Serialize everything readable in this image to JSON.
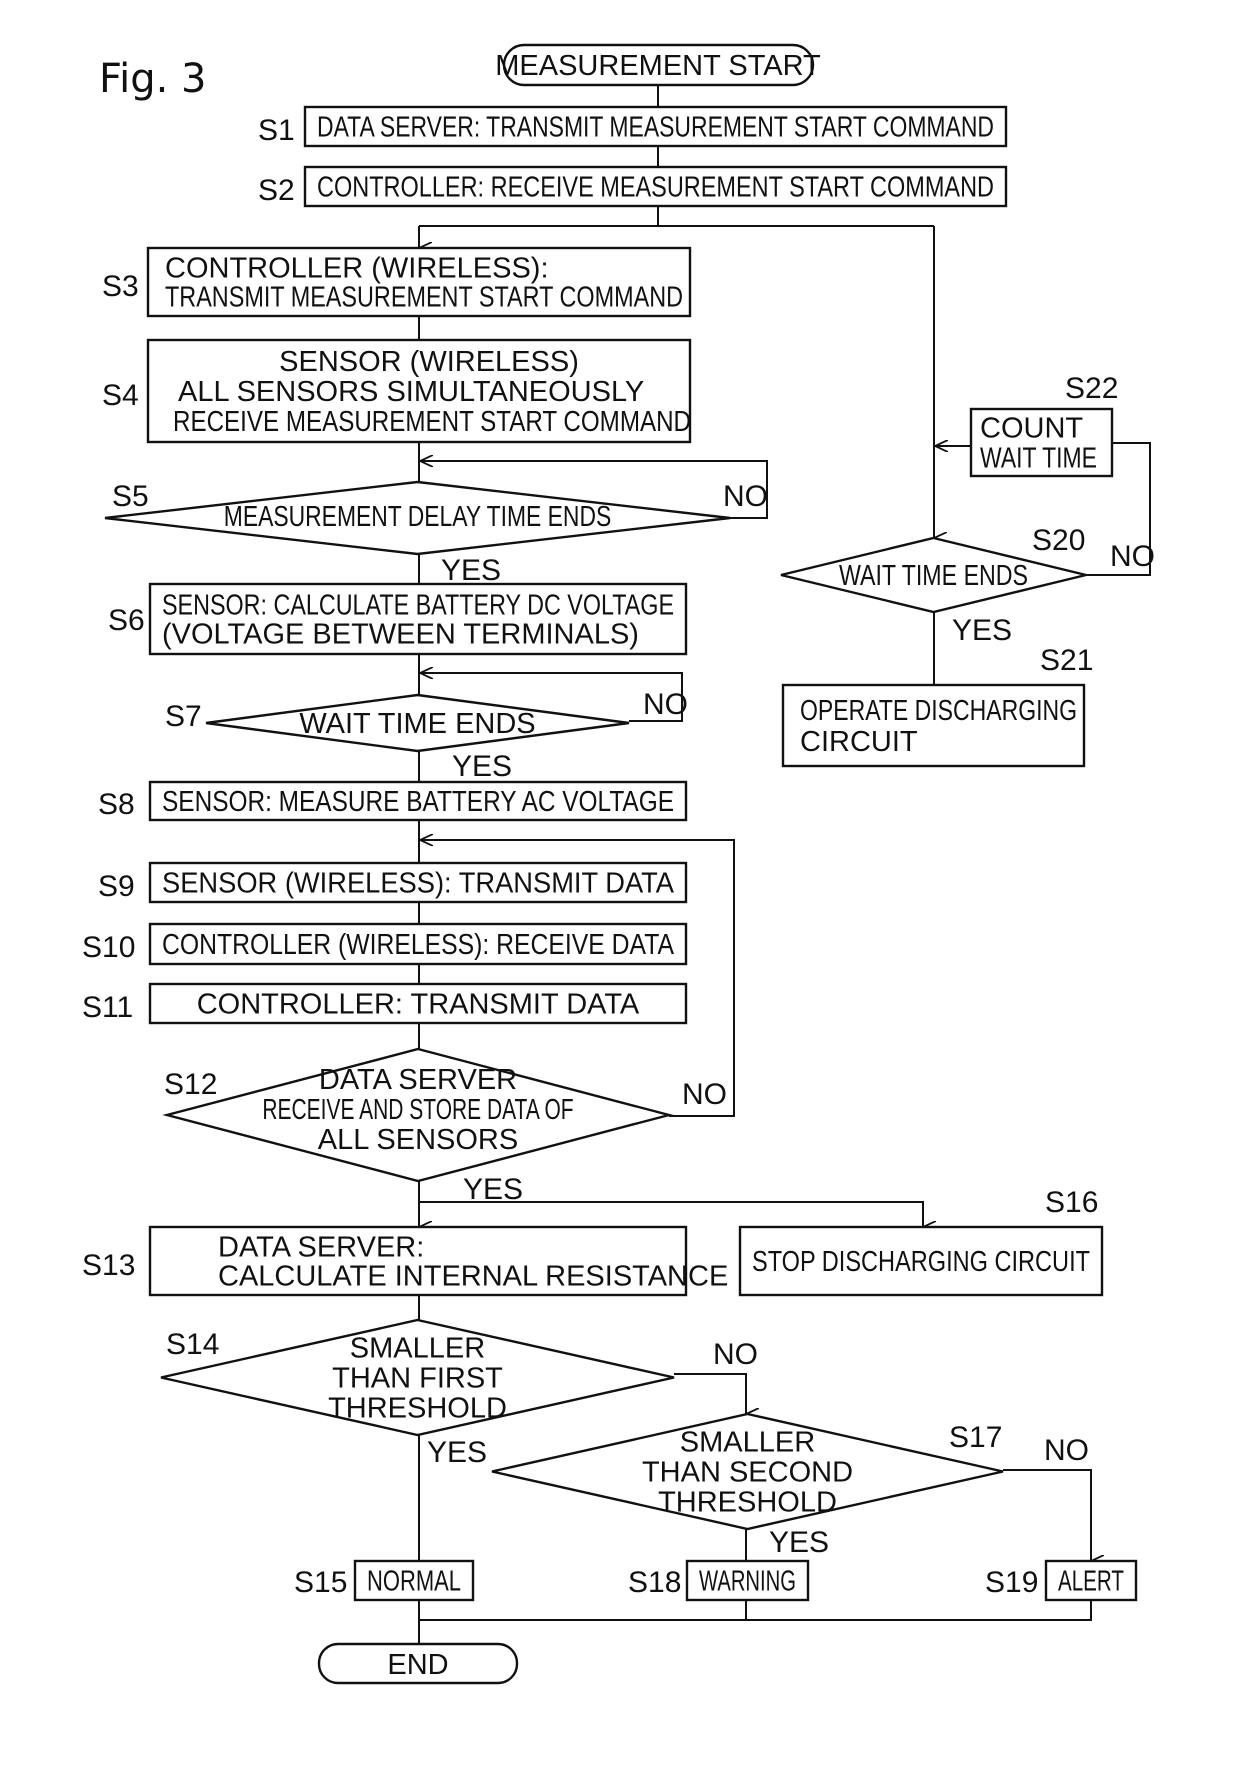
{
  "figure": {
    "title": "Fig. 3"
  },
  "terminals": {
    "start": "MEASUREMENT START",
    "end": "END"
  },
  "steps": {
    "S1": {
      "id": "S1",
      "lines": [
        "DATA SERVER: TRANSMIT MEASUREMENT START COMMAND"
      ]
    },
    "S2": {
      "id": "S2",
      "lines": [
        "CONTROLLER: RECEIVE MEASUREMENT START COMMAND"
      ]
    },
    "S3": {
      "id": "S3",
      "lines": [
        "CONTROLLER (WIRELESS):",
        "TRANSMIT MEASUREMENT START COMMAND"
      ]
    },
    "S4": {
      "id": "S4",
      "lines": [
        "SENSOR (WIRELESS)",
        "ALL SENSORS SIMULTANEOUSLY",
        "RECEIVE MEASUREMENT START COMMAND"
      ]
    },
    "S5": {
      "id": "S5",
      "lines": [
        "MEASUREMENT DELAY TIME ENDS"
      ]
    },
    "S6": {
      "id": "S6",
      "lines": [
        "SENSOR: CALCULATE BATTERY DC VOLTAGE",
        "(VOLTAGE BETWEEN TERMINALS)"
      ]
    },
    "S7": {
      "id": "S7",
      "lines": [
        "WAIT TIME ENDS"
      ]
    },
    "S8": {
      "id": "S8",
      "lines": [
        "SENSOR: MEASURE BATTERY AC VOLTAGE"
      ]
    },
    "S9": {
      "id": "S9",
      "lines": [
        "SENSOR (WIRELESS): TRANSMIT DATA"
      ]
    },
    "S10": {
      "id": "S10",
      "lines": [
        "CONTROLLER (WIRELESS): RECEIVE DATA"
      ]
    },
    "S11": {
      "id": "S11",
      "lines": [
        "CONTROLLER: TRANSMIT DATA"
      ]
    },
    "S12": {
      "id": "S12",
      "lines": [
        "DATA SERVER",
        "RECEIVE AND STORE DATA OF",
        "ALL SENSORS"
      ]
    },
    "S13": {
      "id": "S13",
      "lines": [
        "DATA SERVER:",
        "CALCULATE INTERNAL RESISTANCE"
      ]
    },
    "S14": {
      "id": "S14",
      "lines": [
        "SMALLER",
        "THAN FIRST",
        "THRESHOLD"
      ]
    },
    "S15": {
      "id": "S15",
      "lines": [
        "NORMAL"
      ]
    },
    "S16": {
      "id": "S16",
      "lines": [
        "STOP DISCHARGING CIRCUIT"
      ]
    },
    "S17": {
      "id": "S17",
      "lines": [
        "SMALLER",
        "THAN SECOND",
        "THRESHOLD"
      ]
    },
    "S18": {
      "id": "S18",
      "lines": [
        "WARNING"
      ]
    },
    "S19": {
      "id": "S19",
      "lines": [
        "ALERT"
      ]
    },
    "S20": {
      "id": "S20",
      "lines": [
        "WAIT TIME ENDS"
      ]
    },
    "S21": {
      "id": "S21",
      "lines": [
        "OPERATE DISCHARGING",
        "CIRCUIT"
      ]
    },
    "S22": {
      "id": "S22",
      "lines": [
        "COUNT",
        "WAIT TIME"
      ]
    }
  },
  "branch_labels": {
    "yes": "YES",
    "no": "NO"
  }
}
